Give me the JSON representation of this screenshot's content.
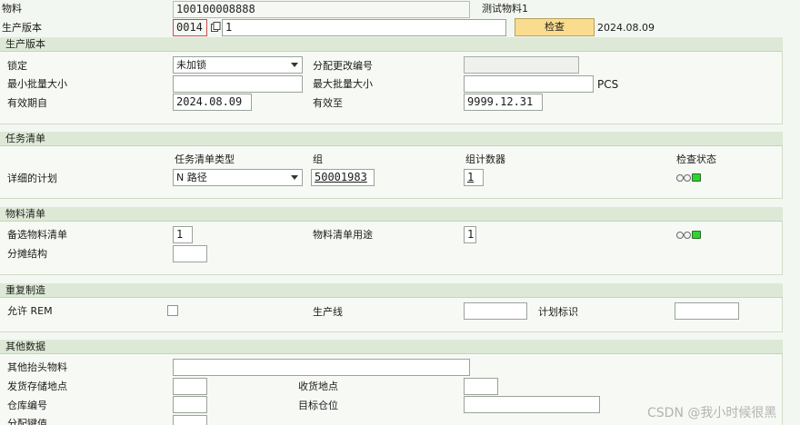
{
  "header": {
    "material_label": "物料",
    "material_value": "100100008888",
    "material_desc": "测试物料1",
    "version_label": "生产版本",
    "version_value": "0014",
    "version_desc": "1",
    "check_button": "检查",
    "check_date": "2024.08.09"
  },
  "production_version": {
    "title": "生产版本",
    "lock_label": "锁定",
    "lock_value": "未加锁",
    "change_no_label": "分配更改编号",
    "change_no_value": "",
    "min_lot_label": "最小批量大小",
    "min_lot_value": "",
    "max_lot_label": "最大批量大小",
    "max_lot_value": "",
    "unit": "PCS",
    "valid_from_label": "有效期自",
    "valid_from_value": "2024.08.09",
    "valid_to_label": "有效至",
    "valid_to_value": "9999.12.31"
  },
  "task_list": {
    "title": "任务清单",
    "col_type": "任务清单类型",
    "col_group": "组",
    "col_counter": "组计数器",
    "col_status": "检查状态",
    "row_label": "详细的计划",
    "type_value": "N 路径",
    "group_value": "50001983",
    "counter_value": "1"
  },
  "bom": {
    "title": "物料清单",
    "alt_bom_label": "备选物料清单",
    "alt_bom_value": "1",
    "usage_label": "物料清单用途",
    "usage_value": "1",
    "apportion_label": "分摊结构",
    "apportion_value": ""
  },
  "rem": {
    "title": "重复制造",
    "allow_label": "允许 REM",
    "line_label": "生产线",
    "line_value": "",
    "plan_id_label": "计划标识",
    "plan_id_value": ""
  },
  "other": {
    "title": "其他数据",
    "other_header_label": "其他抬头物料",
    "issue_sloc_label": "发货存储地点",
    "receive_sloc_label": "收货地点",
    "warehouse_label": "仓库编号",
    "dest_bin_label": "目标仓位",
    "dist_key_label": "分配键值"
  },
  "watermark": "CSDN @我小时候很黑",
  "colors": {
    "background": "#f3f7f1",
    "section_header": "#dde9d6",
    "button": "#f9dc8e",
    "status_green": "#2fd42f"
  }
}
